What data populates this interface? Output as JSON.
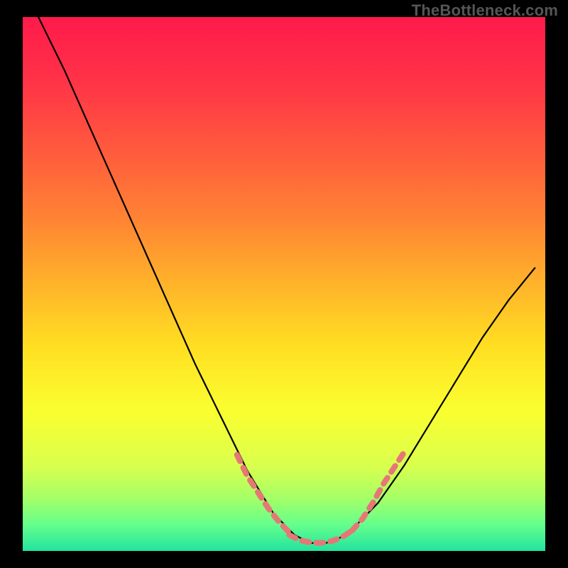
{
  "watermark": "TheBottleneck.com",
  "chart_data": {
    "type": "line",
    "title": "",
    "xlabel": "",
    "ylabel": "",
    "xlim": [
      0,
      100
    ],
    "ylim": [
      0,
      100
    ],
    "grid": false,
    "background_gradient": {
      "type": "vertical",
      "stops": [
        {
          "pos": 0.0,
          "color": "#ff1a4b"
        },
        {
          "pos": 0.12,
          "color": "#ff3347"
        },
        {
          "pos": 0.25,
          "color": "#ff5a3d"
        },
        {
          "pos": 0.38,
          "color": "#ff8433"
        },
        {
          "pos": 0.5,
          "color": "#ffb32a"
        },
        {
          "pos": 0.62,
          "color": "#ffe022"
        },
        {
          "pos": 0.74,
          "color": "#faff30"
        },
        {
          "pos": 0.84,
          "color": "#d9ff4d"
        },
        {
          "pos": 0.9,
          "color": "#a6ff66"
        },
        {
          "pos": 0.95,
          "color": "#66ff8c"
        },
        {
          "pos": 1.0,
          "color": "#22e39e"
        }
      ]
    },
    "series": [
      {
        "name": "bottleneck-curve",
        "color": "#000000",
        "x": [
          3,
          8,
          13,
          18,
          23,
          28,
          33,
          38,
          43,
          48,
          52,
          55,
          58,
          60,
          63,
          68,
          73,
          78,
          83,
          88,
          93,
          98
        ],
        "y": [
          100,
          90,
          79,
          68,
          57,
          46,
          35,
          25,
          15,
          7,
          3,
          1.5,
          1.5,
          2,
          4,
          9,
          16,
          24,
          32,
          40,
          47,
          53
        ]
      }
    ],
    "highlight_segments": [
      {
        "name": "left-dash",
        "color": "#e67777",
        "style": "dashed",
        "x": [
          41,
          43,
          45,
          47,
          49,
          51
        ],
        "y": [
          18,
          14,
          11,
          8,
          5.5,
          3.5
        ]
      },
      {
        "name": "trough-dash",
        "color": "#e67777",
        "style": "dashed",
        "x": [
          51,
          53,
          55,
          57,
          59,
          61,
          63
        ],
        "y": [
          3.0,
          2.0,
          1.6,
          1.5,
          1.8,
          2.5,
          3.8
        ]
      },
      {
        "name": "right-dash",
        "color": "#e67777",
        "style": "dashed",
        "x": [
          63,
          65,
          67,
          69,
          71,
          73
        ],
        "y": [
          3.8,
          6,
          9,
          12.5,
          15.5,
          18.5
        ]
      }
    ]
  }
}
